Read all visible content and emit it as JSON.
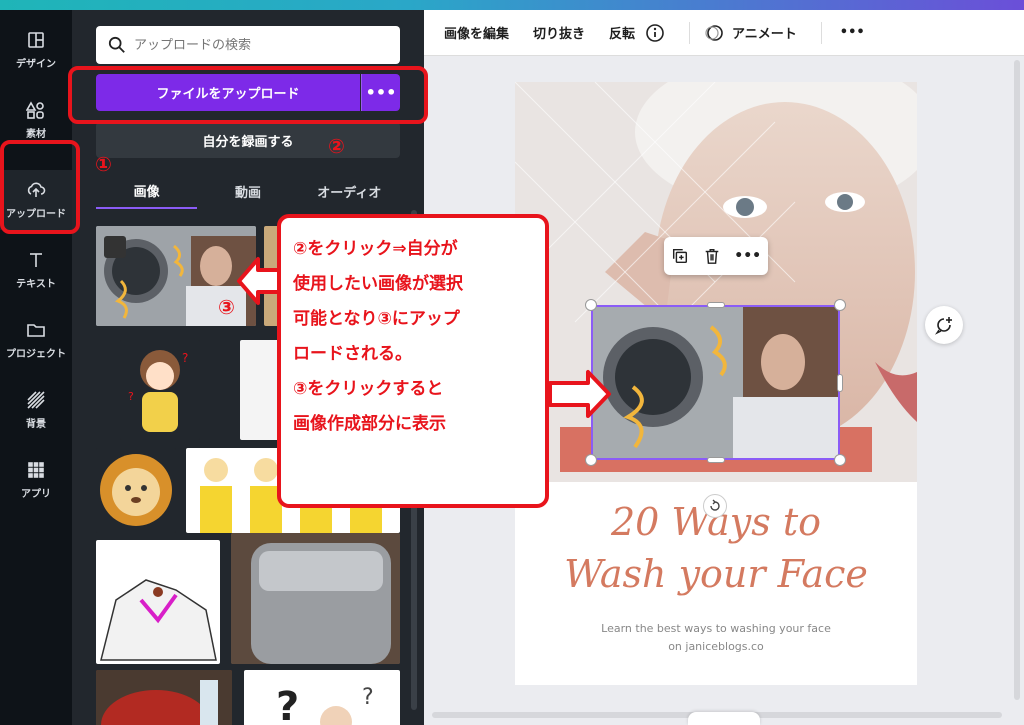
{
  "rail": {
    "items": [
      {
        "label": "デザイン"
      },
      {
        "label": "素材"
      },
      {
        "label": "アップロード"
      },
      {
        "label": "テキスト"
      },
      {
        "label": "プロジェクト"
      },
      {
        "label": "背景"
      },
      {
        "label": "アプリ"
      }
    ]
  },
  "panel": {
    "search_placeholder": "アップロードの検索",
    "upload_label": "ファイルをアップロード",
    "more_label": "•••",
    "record_label": "自分を録画する",
    "tabs": [
      "画像",
      "動画",
      "オーディオ"
    ]
  },
  "toolbar": {
    "edit_image": "画像を編集",
    "crop": "切り抜き",
    "flip": "反転",
    "animate": "アニメート",
    "more": "•••"
  },
  "canvas": {
    "title_line1": "20 Ways to",
    "title_line2": "Wash your Face",
    "subtitle_line1": "Learn the best ways to washing your face",
    "subtitle_line2": "on janiceblogs.co",
    "accent_color": "#d47a60"
  },
  "annotations": {
    "num1": "①",
    "num2": "②",
    "num3": "③",
    "callout_lines": [
      "②をクリック⇒自分が",
      "使用したい画像が選択",
      "可能となり③にアップ",
      "ロードされる。",
      "③をクリックすると",
      "画像作成部分に表示"
    ]
  }
}
